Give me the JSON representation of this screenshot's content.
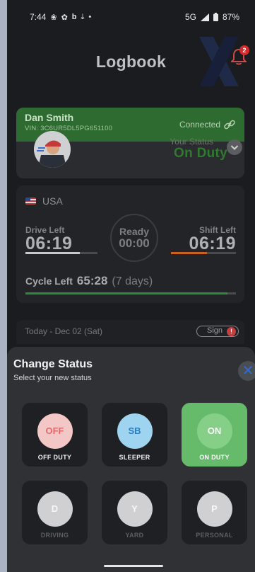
{
  "status_bar": {
    "time": "7:44",
    "network": "5G",
    "battery": "87%"
  },
  "header": {
    "title": "Logbook",
    "notification_count": "2"
  },
  "driver": {
    "name": "Dan Smith",
    "vin": "VIN: 3C6UR5DL5PG651100",
    "connection": "Connected",
    "status_label": "Your Status",
    "status_value": "On Duty"
  },
  "hours": {
    "country": "USA",
    "drive_label": "Drive Left",
    "drive_value": "06:19",
    "drive_progress": 0.75,
    "ready_label": "Ready",
    "ready_value": "00:00",
    "shift_label": "Shift Left",
    "shift_value": "06:19",
    "shift_progress": 0.55,
    "cycle_label": "Cycle Left",
    "cycle_value": "65:28",
    "cycle_days": "(7 days)",
    "cycle_progress": 0.96
  },
  "today": {
    "label": "Today - Dec 02 (Sat)",
    "sign_label": "Sign",
    "sign_alert": "!"
  },
  "sheet": {
    "title": "Change Status",
    "subtitle": "Select your new status",
    "tiles": [
      {
        "code": "OFF",
        "label": "OFF DUTY",
        "selected": false,
        "enabled": true
      },
      {
        "code": "SB",
        "label": "SLEEPER",
        "selected": false,
        "enabled": true
      },
      {
        "code": "ON",
        "label": "ON DUTY",
        "selected": true,
        "enabled": true
      },
      {
        "code": "D",
        "label": "DRIVING",
        "selected": false,
        "enabled": false
      },
      {
        "code": "Y",
        "label": "YARD",
        "selected": false,
        "enabled": false
      },
      {
        "code": "P",
        "label": "PERSONAL",
        "selected": false,
        "enabled": false
      }
    ]
  },
  "colors": {
    "accent_green": "#66bb6a",
    "off_duty": "#f4c7c7",
    "sleeper": "#9fd4f0",
    "on_duty_circle": "#86cf88",
    "close_icon": "#2f6dd6",
    "drive_bar": "#c9c9c9",
    "shift_bar": "#c8621e",
    "cycle_bar": "#2e8b3a"
  }
}
